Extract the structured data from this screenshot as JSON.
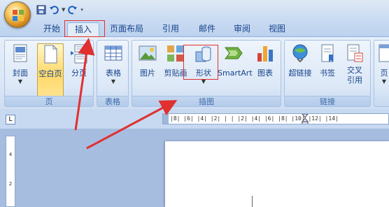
{
  "tabs": [
    "开始",
    "插入",
    "页面布局",
    "引用",
    "邮件",
    "审阅",
    "视图"
  ],
  "active_tab": "插入",
  "groups": {
    "page": {
      "label": "页",
      "buttons": [
        "封面",
        "空白页",
        "分页"
      ]
    },
    "table": {
      "label": "表格",
      "buttons": [
        "表格"
      ]
    },
    "illustrations": {
      "label": "插图",
      "buttons": [
        "图片",
        "剪贴画",
        "形状",
        "SmartArt",
        "图表"
      ]
    },
    "links": {
      "label": "链接",
      "buttons": [
        "超链接",
        "书签",
        "交叉\n引用"
      ]
    },
    "header": {
      "buttons": [
        "页"
      ]
    }
  },
  "ruler_text": "|8| |6| |4| |2| | | |2| |4| |6| |8| |10| |12| |14|",
  "vruler_text": [
    "4",
    "2"
  ],
  "ruler_corner": "L",
  "colors": {
    "annotation": "#e03030",
    "ribbon": "#dbe7f6",
    "selected_button": "#ffd968"
  },
  "icons": {
    "office": "office-logo-icon",
    "save": "save-icon",
    "undo": "undo-icon",
    "redo": "redo-icon"
  }
}
